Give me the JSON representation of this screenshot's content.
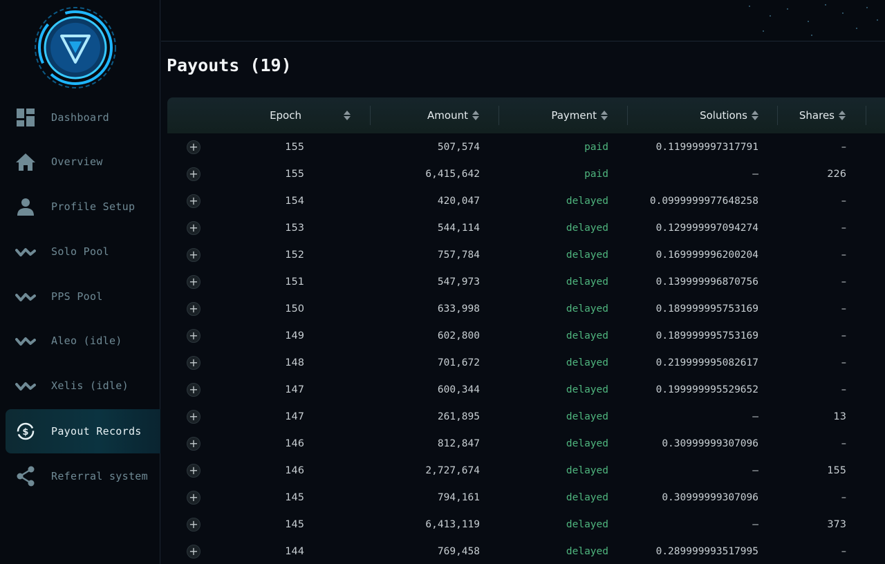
{
  "sidebar": {
    "items": [
      {
        "label": "Dashboard",
        "icon": "dashboard-icon"
      },
      {
        "label": "Overview",
        "icon": "home-icon"
      },
      {
        "label": "Profile Setup",
        "icon": "user-icon"
      },
      {
        "label": "Solo Pool",
        "icon": "wave-icon"
      },
      {
        "label": "PPS Pool",
        "icon": "wave-icon"
      },
      {
        "label": "Aleo (idle)",
        "icon": "wave-icon"
      },
      {
        "label": "Xelis (idle)",
        "icon": "wave-icon"
      },
      {
        "label": "Payout Records",
        "icon": "dollar-cycle-icon",
        "active": true
      },
      {
        "label": "Referral system",
        "icon": "share-icon"
      }
    ]
  },
  "page": {
    "title": "Payouts (19)"
  },
  "table": {
    "headers": {
      "epoch": "Epoch",
      "amount": "Amount",
      "payment": "Payment",
      "solutions": "Solutions",
      "shares": "Shares"
    },
    "expand_symbol": "+",
    "rows": [
      {
        "epoch": "155",
        "amount": "507,574",
        "payment": "paid",
        "solutions": "0.119999997317791",
        "shares": "–"
      },
      {
        "epoch": "155",
        "amount": "6,415,642",
        "payment": "paid",
        "solutions": "–",
        "shares": "226"
      },
      {
        "epoch": "154",
        "amount": "420,047",
        "payment": "delayed",
        "solutions": "0.0999999977648258",
        "shares": "–"
      },
      {
        "epoch": "153",
        "amount": "544,114",
        "payment": "delayed",
        "solutions": "0.129999997094274",
        "shares": "–"
      },
      {
        "epoch": "152",
        "amount": "757,784",
        "payment": "delayed",
        "solutions": "0.169999996200204",
        "shares": "–"
      },
      {
        "epoch": "151",
        "amount": "547,973",
        "payment": "delayed",
        "solutions": "0.139999996870756",
        "shares": "–"
      },
      {
        "epoch": "150",
        "amount": "633,998",
        "payment": "delayed",
        "solutions": "0.189999995753169",
        "shares": "–"
      },
      {
        "epoch": "149",
        "amount": "602,800",
        "payment": "delayed",
        "solutions": "0.189999995753169",
        "shares": "–"
      },
      {
        "epoch": "148",
        "amount": "701,672",
        "payment": "delayed",
        "solutions": "0.219999995082617",
        "shares": "–"
      },
      {
        "epoch": "147",
        "amount": "600,344",
        "payment": "delayed",
        "solutions": "0.199999995529652",
        "shares": "–"
      },
      {
        "epoch": "147",
        "amount": "261,895",
        "payment": "delayed",
        "solutions": "–",
        "shares": "13"
      },
      {
        "epoch": "146",
        "amount": "812,847",
        "payment": "delayed",
        "solutions": "0.30999999307096",
        "shares": "–"
      },
      {
        "epoch": "146",
        "amount": "2,727,674",
        "payment": "delayed",
        "solutions": "–",
        "shares": "155"
      },
      {
        "epoch": "145",
        "amount": "794,161",
        "payment": "delayed",
        "solutions": "0.30999999307096",
        "shares": "–"
      },
      {
        "epoch": "145",
        "amount": "6,413,119",
        "payment": "delayed",
        "solutions": "–",
        "shares": "373"
      },
      {
        "epoch": "144",
        "amount": "769,458",
        "payment": "delayed",
        "solutions": "0.289999993517995",
        "shares": "–"
      }
    ]
  },
  "colors": {
    "accent": "#1fb6ff",
    "paid": "#4fb57e",
    "background": "#070b12"
  }
}
